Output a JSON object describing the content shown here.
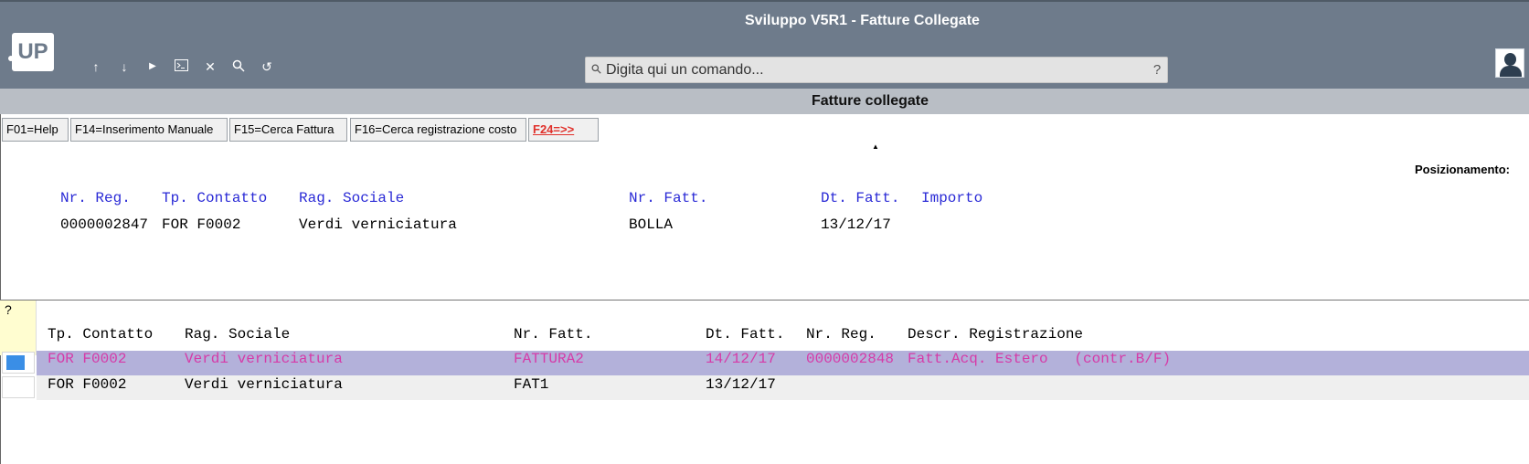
{
  "header": {
    "title": "Sviluppo V5R1 - Fatture Collegate",
    "logo_text": "UP",
    "toolbar_icons": [
      "arrow-up-icon",
      "arrow-down-icon",
      "play-icon",
      "terminal-icon",
      "close-icon",
      "search-icon",
      "undo-icon"
    ],
    "search_placeholder": "Digita qui un comando...",
    "search_help": "?"
  },
  "panel": {
    "title": "Fatture collegate",
    "fkeys": [
      "F01=Help",
      "F14=Inserimento Manuale",
      "F15=Cerca Fattura",
      "F16=Cerca registrazione costo",
      "F24=>>"
    ],
    "positioning_label": "Posizionamento:"
  },
  "header_record": {
    "columns": [
      "Nr. Reg.",
      "Tp. Contatto",
      "Rag. Sociale",
      "Nr. Fatt.",
      "Dt. Fatt.",
      "Importo"
    ],
    "values": [
      "0000002847",
      "FOR F0002",
      "Verdi verniciatura",
      "BOLLA",
      "13/12/17",
      ""
    ]
  },
  "list": {
    "selector_header": "?",
    "columns": [
      "Tp. Contatto",
      "Rag. Sociale",
      "Nr. Fatt.",
      "Dt. Fatt.",
      "Nr. Reg.",
      "Descr. Registrazione"
    ],
    "rows": [
      {
        "tp_contatto": "FOR F0002",
        "rag_sociale": "Verdi verniciatura",
        "nr_fatt": "FATTURA2",
        "dt_fatt": "14/12/17",
        "nr_reg": "0000002848",
        "descr": "Fatt.Acq. Estero   (contr.B/F)"
      },
      {
        "tp_contatto": "FOR F0002",
        "rag_sociale": "Verdi verniciatura",
        "nr_fatt": "FAT1",
        "dt_fatt": "13/12/17",
        "nr_reg": "",
        "descr": ""
      }
    ]
  },
  "colors": {
    "header_bg": "#6e7b8b",
    "field_label": "#2a2ad6",
    "selected_row_text": "#d63aa8",
    "selected_row_bg": "#b3b1da",
    "fkey_highlight": "#e0302a"
  }
}
